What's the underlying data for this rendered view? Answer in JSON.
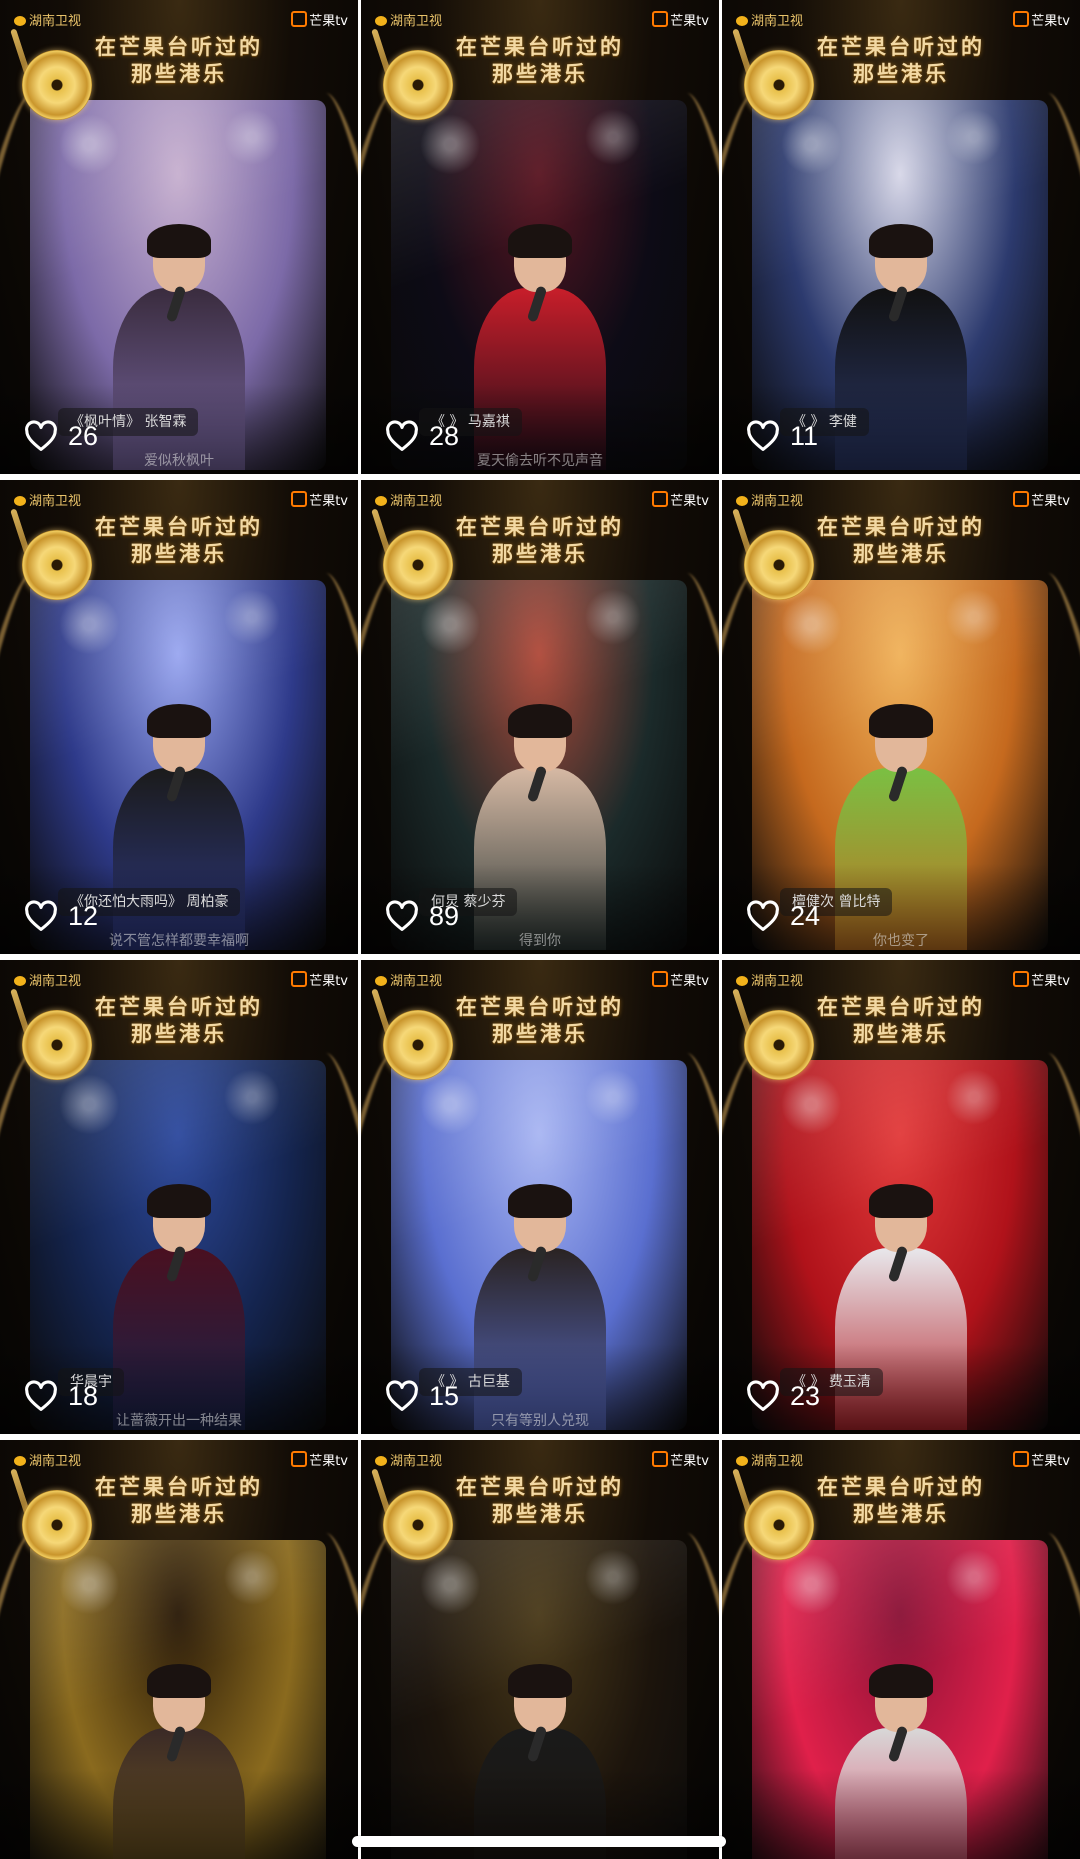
{
  "brand": {
    "channel_logo": "湖南卫视",
    "app_logo": "芒果tv",
    "banner_title_line1": "在芒果台听过的",
    "banner_title_line2": "那些港乐"
  },
  "icons": {
    "like": "heart-outline-icon",
    "record": "gold-record-icon"
  },
  "colors": {
    "tile_background": "#120c06",
    "title_gold": "#f3d9a4",
    "accent_gold": "#e8c04a",
    "text_white": "#ffffff"
  },
  "videos": [
    {
      "likes": "26",
      "caption": "《枫叶情》 张智霖",
      "subtitle": "爱似秋枫叶",
      "palette": [
        "#7c6aa8",
        "#c7b0cf",
        "#3a2c3e"
      ]
    },
    {
      "likes": "28",
      "caption": "《 》 马嘉祺",
      "subtitle": "夏天偷去听不见声音",
      "palette": [
        "#0d0b16",
        "#5a1622",
        "#c81e2a"
      ]
    },
    {
      "likes": "11",
      "caption": "《 》 李健",
      "subtitle": "",
      "palette": [
        "#2c3a6e",
        "#d7d7e8",
        "#111111"
      ]
    },
    {
      "likes": "12",
      "caption": "《你还怕大雨吗》 周柏豪",
      "subtitle": "说不管怎样都要幸福啊",
      "palette": [
        "#2e3a8a",
        "#9aa7f0",
        "#1b1b1b"
      ]
    },
    {
      "likes": "89",
      "caption": "何炅 蔡少芬",
      "subtitle": "得到你",
      "palette": [
        "#1b2a2a",
        "#b04a3a",
        "#d6b9a4"
      ]
    },
    {
      "likes": "24",
      "caption": "檀健次 曾比特",
      "subtitle": "你也变了",
      "palette": [
        "#c5691e",
        "#f0b25a",
        "#7ac043"
      ]
    },
    {
      "likes": "18",
      "caption": "华晨宇",
      "subtitle": "让蔷薇开出一种结果",
      "palette": [
        "#14244e",
        "#2e4a9e",
        "#4a1020"
      ]
    },
    {
      "likes": "15",
      "caption": "《 》 古巨基",
      "subtitle": "只有等别人兑现",
      "palette": [
        "#5a6fd0",
        "#a9b6f2",
        "#2a2322"
      ]
    },
    {
      "likes": "23",
      "caption": "《 》 费玉清",
      "subtitle": "",
      "palette": [
        "#b0121a",
        "#e23b3b",
        "#e8e8ec"
      ]
    },
    {
      "likes": "",
      "caption": "",
      "subtitle": "",
      "palette": [
        "#8a6a1e",
        "#2a1a08",
        "#3a2a26"
      ]
    },
    {
      "likes": "",
      "caption": "",
      "subtitle": "",
      "palette": [
        "#1c140c",
        "#4a3a1a",
        "#1a1a1a"
      ]
    },
    {
      "likes": "",
      "caption": "",
      "subtitle": "",
      "palette": [
        "#e0204a",
        "#8a1236",
        "#d8d8d8"
      ]
    }
  ]
}
